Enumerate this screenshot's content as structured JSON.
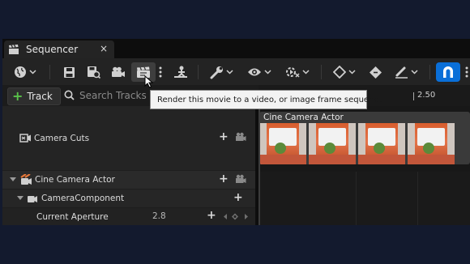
{
  "tab": {
    "title": "Sequencer",
    "close_glyph": "×",
    "icon": "clapperboard-icon"
  },
  "toolbar": {
    "buttons": [
      {
        "name": "world-icon",
        "dropdown": true
      },
      {
        "name": "save-icon"
      },
      {
        "name": "save-as-icon"
      },
      {
        "name": "camera-icon"
      },
      {
        "name": "render-movie-icon",
        "active": true
      },
      {
        "name": "more-options-icon"
      },
      {
        "name": "animation-icon"
      },
      {
        "name": "wrench-icon",
        "dropdown": true
      },
      {
        "name": "eye-icon",
        "dropdown": true
      },
      {
        "name": "playback-icon",
        "dropdown": true
      },
      {
        "name": "keyframe-icon",
        "dropdown": true
      },
      {
        "name": "key-tag-icon"
      },
      {
        "name": "brush-icon",
        "dropdown": true
      },
      {
        "name": "snap-magnet-icon",
        "highlight": "#0a6fd8"
      }
    ]
  },
  "trackbar": {
    "add_track_label": "Track",
    "search_placeholder": "Search Tracks",
    "ruler_label": "2.50"
  },
  "tooltip": {
    "text": "Render this movie to a video, or image frame sequence"
  },
  "outliner": {
    "rows": [
      {
        "label": "Camera Cuts"
      },
      {
        "label": "Cine Camera Actor"
      },
      {
        "label": "CameraComponent"
      },
      {
        "label": "Current Aperture",
        "value": "2.8"
      }
    ]
  },
  "timeline": {
    "clip_label": "Cine Camera Actor"
  },
  "colors": {
    "accent": "#0a6fd8",
    "add_green": "#59c24a",
    "background": "#131a2e"
  }
}
